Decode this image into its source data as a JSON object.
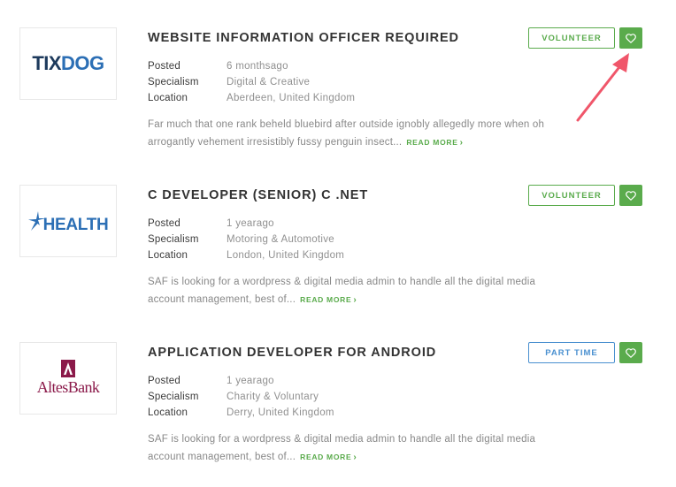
{
  "jobs": [
    {
      "title": "WEBSITE INFORMATION OFFICER REQUIRED",
      "company_logo": "TIXDOG",
      "type": "VOLUNTEER",
      "type_color": "#5aab4c",
      "posted_label": "Posted",
      "posted": "6 monthsago",
      "specialism_label": "Specialism",
      "specialism": "Digital & Creative",
      "location_label": "Location",
      "location": "Aberdeen, United Kingdom",
      "description": "Far much that one rank beheld bluebird after outside ignobly allegedly more when oh arrogantly vehement irresistibly fussy penguin insect...",
      "read_more": "READ MORE"
    },
    {
      "title": "C DEVELOPER (SENIOR) C .NET",
      "company_logo": "HEALTH",
      "type": "VOLUNTEER",
      "type_color": "#5aab4c",
      "posted_label": "Posted",
      "posted": "1 yearago",
      "specialism_label": "Specialism",
      "specialism": "Motoring & Automotive",
      "location_label": "Location",
      "location": "London, United Kingdom",
      "description": "SAF is looking for a wordpress & digital media admin to handle all the digital media account management, best of...",
      "read_more": "READ MORE"
    },
    {
      "title": "APPLICATION DEVELOPER FOR ANDROID",
      "company_logo": "AltesBank",
      "type": "PART TIME",
      "type_color": "#4a90d0",
      "posted_label": "Posted",
      "posted": "1 yearago",
      "specialism_label": "Specialism",
      "specialism": "Charity & Voluntary",
      "location_label": "Location",
      "location": "Derry, United Kingdom",
      "description": "SAF is looking for a wordpress & digital media admin to handle all the digital media account management, best of...",
      "read_more": "READ MORE"
    }
  ],
  "icons": {
    "favorite": "heart-outline-icon",
    "read_more": "chevron-right-icon",
    "annotation": "red-arrow-pointer"
  },
  "colors": {
    "accent_green": "#5aab4c",
    "accent_blue": "#4a90d0",
    "annotation_red": "#f0566a",
    "logo_blue": "#2c6fb5",
    "logo_dark": "#1d3a5c",
    "logo_maroon": "#8b1a4a"
  }
}
